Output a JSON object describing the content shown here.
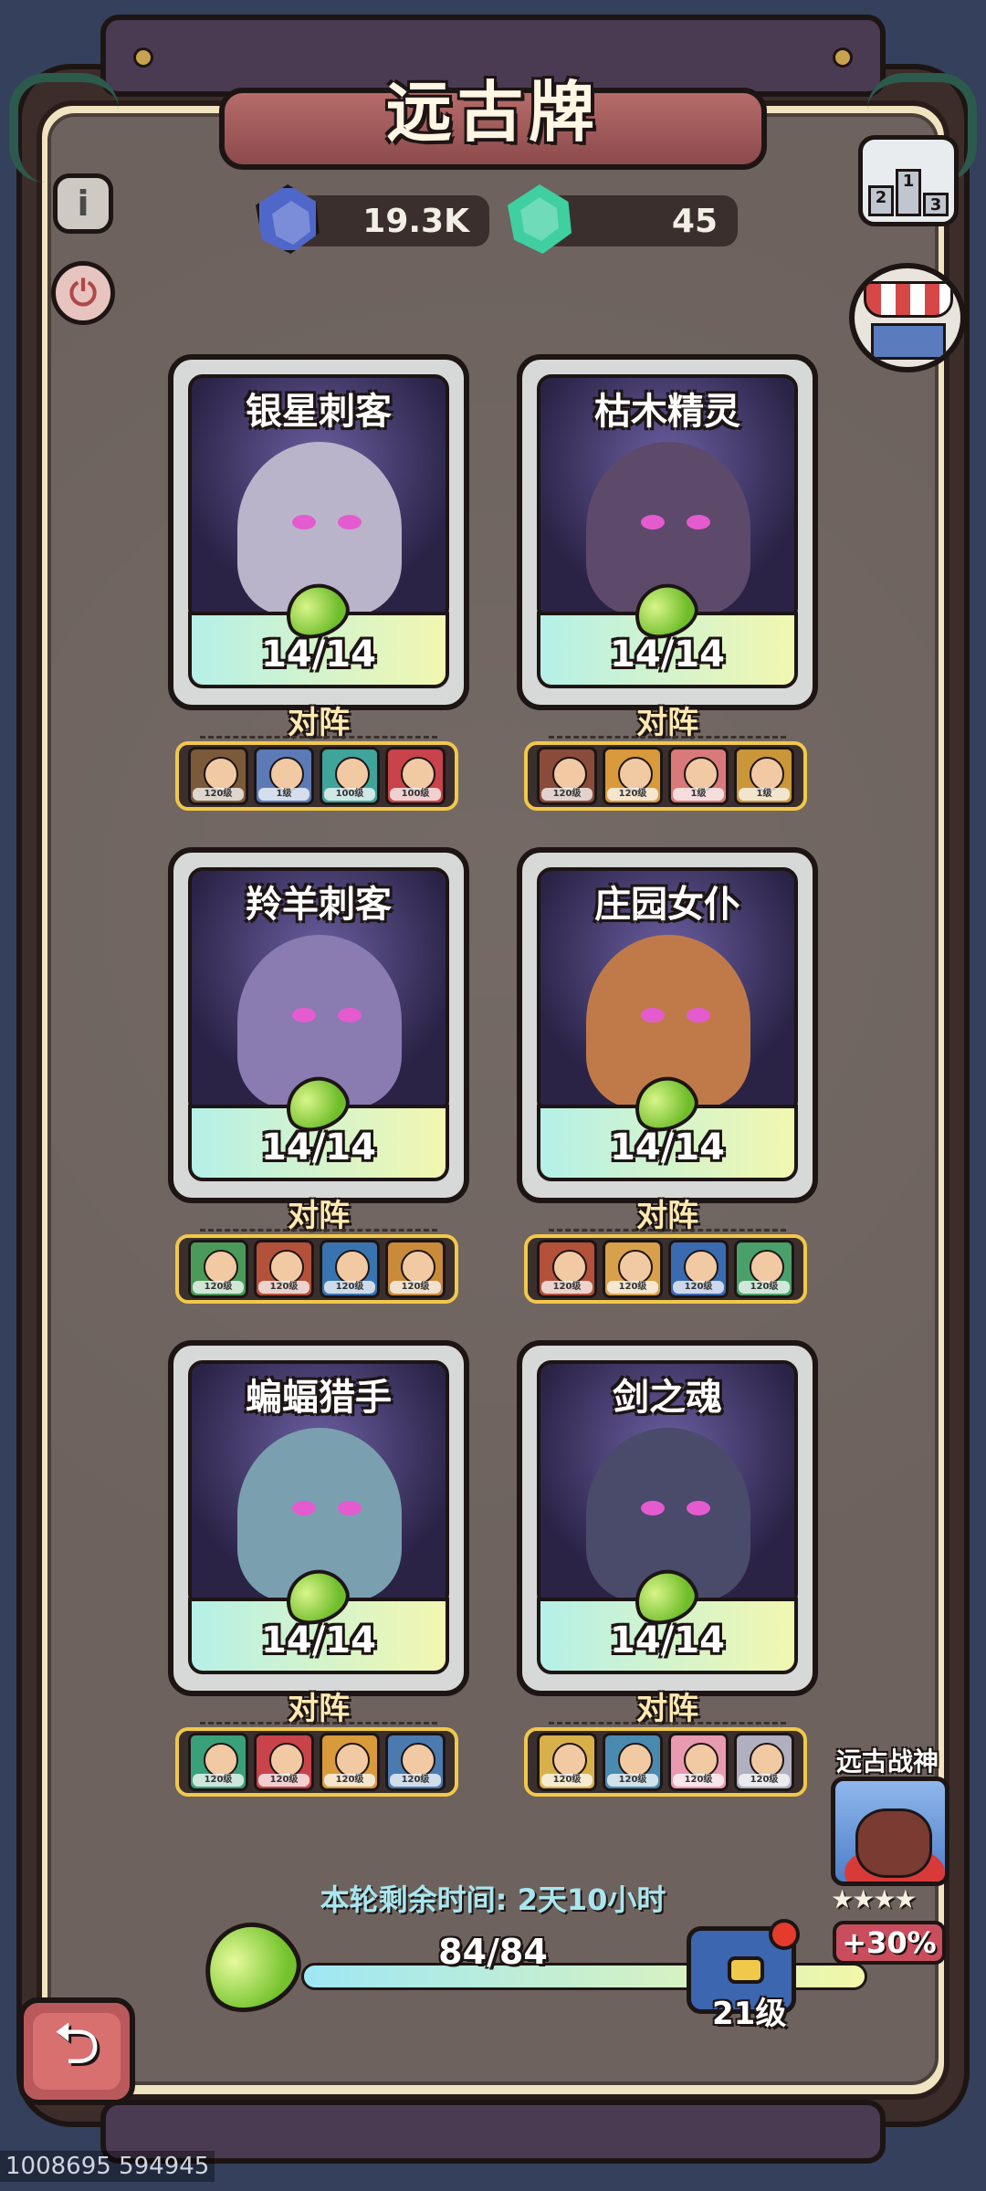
{
  "page_title": "远古牌",
  "currency": {
    "blue_amount": "19.3K",
    "green_amount": "45"
  },
  "buttons": {
    "info_icon": "i",
    "power_icon": "⏻",
    "podium_labels": [
      "2",
      "1",
      "3"
    ],
    "back_icon": "⮌"
  },
  "cards": [
    {
      "name": "银星刺客",
      "count": "14/14",
      "lineup_label": "对阵",
      "lineup_levels": [
        "120级",
        "1级",
        "100级",
        "100级"
      ],
      "art_color": "#b9b4c9",
      "mini_colors": [
        "#7b5a3a",
        "#5b7ab6",
        "#3fa49a",
        "#c9434a"
      ]
    },
    {
      "name": "枯木精灵",
      "count": "14/14",
      "lineup_label": "对阵",
      "lineup_levels": [
        "120级",
        "120级",
        "1级",
        "1级"
      ],
      "art_color": "#5d4a6b",
      "mini_colors": [
        "#8a4b3a",
        "#d89a3a",
        "#d87a7a",
        "#c9963a"
      ]
    },
    {
      "name": "羚羊刺客",
      "count": "14/14",
      "lineup_label": "对阵",
      "lineup_levels": [
        "120级",
        "120级",
        "120级",
        "120级"
      ],
      "art_color": "#8a7bb0",
      "mini_colors": [
        "#4a9a5a",
        "#b3513a",
        "#3a74b0",
        "#c98a3a"
      ]
    },
    {
      "name": "庄园女仆",
      "count": "14/14",
      "lineup_label": "对阵",
      "lineup_levels": [
        "120级",
        "120级",
        "120级",
        "120级"
      ],
      "art_color": "#c07a4a",
      "mini_colors": [
        "#b3513a",
        "#d8a04a",
        "#3a6ab0",
        "#4aa06a"
      ]
    },
    {
      "name": "蝙蝠猎手",
      "count": "14/14",
      "lineup_label": "对阵",
      "lineup_levels": [
        "120级",
        "120级",
        "120级",
        "120级"
      ],
      "art_color": "#7aa0b0",
      "mini_colors": [
        "#3aa07a",
        "#c9434a",
        "#d89a3a",
        "#4a7ab0"
      ]
    },
    {
      "name": "剑之魂",
      "count": "14/14",
      "lineup_label": "对阵",
      "lineup_levels": [
        "120级",
        "120级",
        "120级",
        "120级"
      ],
      "art_color": "#4a4a6a",
      "mini_colors": [
        "#d8b04a",
        "#4a8ab0",
        "#e89ab0",
        "#b0b0c0"
      ]
    }
  ],
  "footer": {
    "timer_text": "本轮剩余时间: 2天10小时",
    "progress_text": "84/84",
    "progress_fraction": 1.0,
    "level_text": "21级"
  },
  "ancient_god": {
    "label": "远古战神",
    "stars": "★★★★",
    "bonus": "+30%"
  },
  "debug_id": "1008695 594945"
}
